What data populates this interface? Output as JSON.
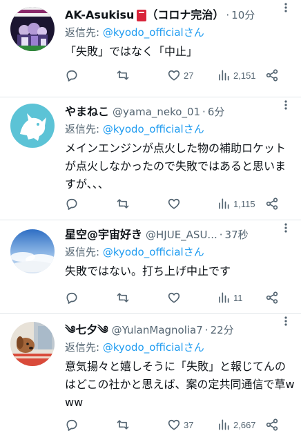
{
  "tweets": [
    {
      "name": "AK-Asukisu",
      "name_suffix": "（コロナ完治）",
      "handle": "",
      "sep": "·",
      "time": "10分",
      "reply_prefix": "返信先: ",
      "reply_to": "@kyodo_official",
      "reply_suffix": "さん",
      "text": "「失敗」ではなく「中止」",
      "replies": "",
      "retweets": "",
      "likes": "27",
      "views": "2,151"
    },
    {
      "name": "やまねこ",
      "name_suffix": "",
      "handle": "@yama_neko_01",
      "sep": "·",
      "time": "6分",
      "reply_prefix": "返信先: ",
      "reply_to": "@kyodo_official",
      "reply_suffix": "さん",
      "text": "メインエンジンが点火した物の補助ロケットが点火しなかったので失敗ではあると思いますが、、、",
      "replies": "",
      "retweets": "",
      "likes": "",
      "views": "1,115"
    },
    {
      "name": "星空@宇宙好き",
      "name_suffix": "",
      "handle": "@HJUE_ASU...",
      "sep": "·",
      "time": "37秒",
      "reply_prefix": "返信先: ",
      "reply_to": "@kyodo_official",
      "reply_suffix": "さん",
      "text": "失敗ではない。打ち上げ中止です",
      "replies": "",
      "retweets": "",
      "likes": "",
      "views": "11"
    },
    {
      "name": "༄七夕༄",
      "name_suffix": "",
      "handle": "@YulanMagnolia7",
      "sep": "·",
      "time": "22分",
      "reply_prefix": "返信先: ",
      "reply_to": "@kyodo_official",
      "reply_suffix": "さん",
      "text": "意気揚々と嬉しそうに「失敗」と報じてんのはどこの社かと思えば、案の定共同通信で草www",
      "replies": "",
      "retweets": "",
      "likes": "37",
      "views": "2,667"
    }
  ],
  "icons": {
    "reply": "reply-icon",
    "retweet": "retweet-icon",
    "like": "heart-icon",
    "views": "views-bar-chart-icon",
    "share": "share-icon",
    "more": "more-dots-icon"
  },
  "colors": {
    "accent": "#1d9bf0",
    "secondary_text": "#536471",
    "divider": "#e1e6ea",
    "verified_book_red": "#d8243a"
  }
}
